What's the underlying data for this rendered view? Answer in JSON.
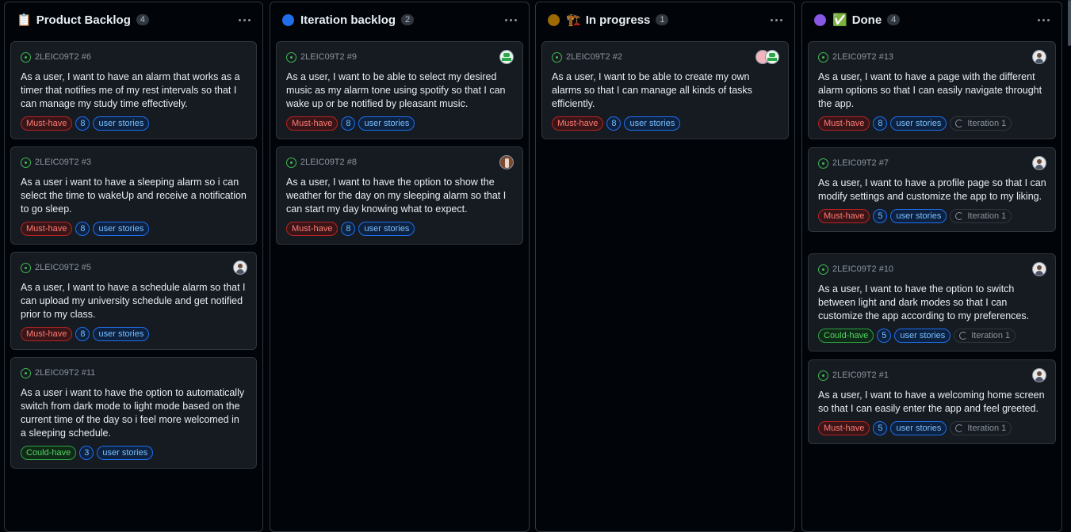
{
  "columns": [
    {
      "title": "Product Backlog",
      "emoji": "📋",
      "dot_color": "",
      "count": "4",
      "cards": [
        {
          "ref": "2LEIC09T2 #6",
          "avatars": [],
          "text": "As a user, I want to have an alarm that works as a timer that notifies me of my rest intervals so that I can manage my study time effectively.",
          "priority": "Must-have",
          "priority_kind": "must",
          "size": "8",
          "type": "user stories",
          "iteration": ""
        },
        {
          "ref": "2LEIC09T2 #3",
          "avatars": [],
          "text": "As a user i want to have a sleeping alarm so i can select the time to wakeUp and receive a notification to go sleep.",
          "priority": "Must-have",
          "priority_kind": "must",
          "size": "8",
          "type": "user stories",
          "iteration": ""
        },
        {
          "ref": "2LEIC09T2 #5",
          "avatars": [
            "person"
          ],
          "text": "As a user, I want to have a schedule alarm so that I can upload my university schedule and get notified prior to my class.",
          "priority": "Must-have",
          "priority_kind": "must",
          "size": "8",
          "type": "user stories",
          "iteration": ""
        },
        {
          "ref": "2LEIC09T2 #11",
          "avatars": [],
          "text": "As a user i want to have the option to automatically switch from dark mode to light mode based on the current time of the day so i feel more welcomed in a sleeping schedule.",
          "priority": "Could-have",
          "priority_kind": "could",
          "size": "3",
          "type": "user stories",
          "iteration": ""
        }
      ]
    },
    {
      "title": "Iteration backlog",
      "emoji": "",
      "dot_color": "#1f6feb",
      "count": "2",
      "cards": [
        {
          "ref": "2LEIC09T2 #9",
          "avatars": [
            "green"
          ],
          "text": "As a user, I want to be able to select my desired music as my alarm tone using spotify so that I can wake up or be notified by pleasant music.",
          "priority": "Must-have",
          "priority_kind": "must",
          "size": "8",
          "type": "user stories",
          "iteration": ""
        },
        {
          "ref": "2LEIC09T2 #8",
          "avatars": [
            "photo"
          ],
          "text": "As a user, I want to have the option to show the weather for the day on my sleeping alarm so that I can start my day knowing what to expect.",
          "priority": "Must-have",
          "priority_kind": "must",
          "size": "8",
          "type": "user stories",
          "iteration": ""
        }
      ]
    },
    {
      "title": "In progress",
      "emoji": "🏗️",
      "dot_color": "#9e6a03",
      "count": "1",
      "cards": [
        {
          "ref": "2LEIC09T2 #2",
          "avatars": [
            "pink",
            "green"
          ],
          "text": "As a user, I want to be able to create my own alarms so that I can manage all kinds of tasks efficiently.",
          "priority": "Must-have",
          "priority_kind": "must",
          "size": "8",
          "type": "user stories",
          "iteration": ""
        }
      ]
    },
    {
      "title": "Done",
      "emoji": "✅",
      "dot_color": "#8957e5",
      "count": "4",
      "cards": [
        {
          "ref": "2LEIC09T2 #13",
          "avatars": [
            "person"
          ],
          "text": "As a user, I want to have a page with the different alarm options so that I can easily navigate throught the app.",
          "priority": "Must-have",
          "priority_kind": "must",
          "size": "8",
          "type": "user stories",
          "iteration": "Iteration 1"
        },
        {
          "ref": "2LEIC09T2 #7",
          "avatars": [
            "person"
          ],
          "text": "As a user, I want to have a profile page so that I can modify settings and customize the app to my liking.",
          "priority": "Must-have",
          "priority_kind": "must",
          "size": "5",
          "type": "user stories",
          "iteration": "Iteration 1"
        },
        {
          "ref": "2LEIC09T2 #10",
          "avatars": [
            "person"
          ],
          "text": "As a user, I want to have the option to switch between light and dark modes so that I can customize the app according to my preferences.",
          "priority": "Could-have",
          "priority_kind": "could",
          "size": "5",
          "type": "user stories",
          "iteration": "Iteration 1"
        },
        {
          "ref": "2LEIC09T2 #1",
          "avatars": [
            "person"
          ],
          "text": "As a user, I want to have a welcoming home screen so that I can easily enter the app and feel greeted.",
          "priority": "Must-have",
          "priority_kind": "must",
          "size": "5",
          "type": "user stories",
          "iteration": "Iteration 1"
        }
      ]
    }
  ]
}
